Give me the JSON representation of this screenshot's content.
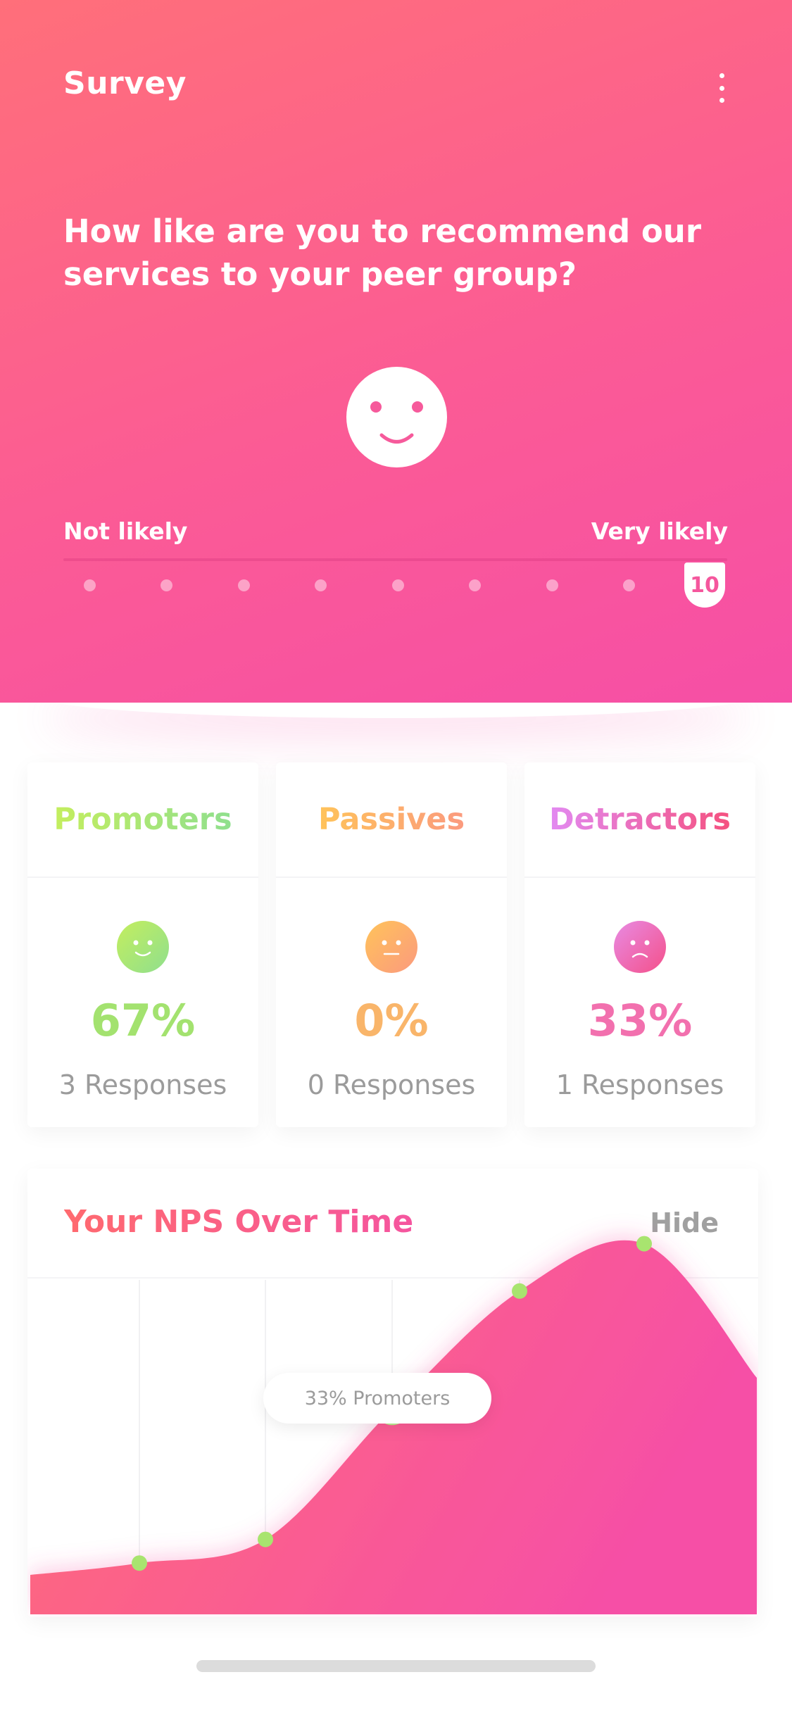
{
  "header": {
    "title": "Survey",
    "menu_icon": "more-vertical-icon",
    "question": "How like are you to recommend our services to your peer group?",
    "face_icon": "smile-face-icon",
    "scale": {
      "left_label": "Not likely",
      "right_label": "Very likely",
      "selected_value": "10",
      "steps": 10
    },
    "colors": {
      "gradient_start": "#ff6f7a",
      "gradient_end": "#f64fa6"
    }
  },
  "stats": [
    {
      "title": "Promoters",
      "icon": "happy-face-icon",
      "percent": "67%",
      "responses": "3 Responses"
    },
    {
      "title": "Passives",
      "icon": "neutral-face-icon",
      "percent": "0%",
      "responses": "0 Responses"
    },
    {
      "title": "Detractors",
      "icon": "sad-face-icon",
      "percent": "33%",
      "responses": "1 Responses"
    }
  ],
  "nps": {
    "title": "Your NPS Over Time",
    "hide_label": "Hide",
    "tooltip": "33% Promoters"
  },
  "chart_data": {
    "type": "area",
    "title": "Your NPS Over Time",
    "x": [
      1,
      2,
      3,
      4,
      5
    ],
    "values": [
      13,
      19,
      52,
      82,
      94
    ],
    "selected_index": 2,
    "grid": true
  }
}
